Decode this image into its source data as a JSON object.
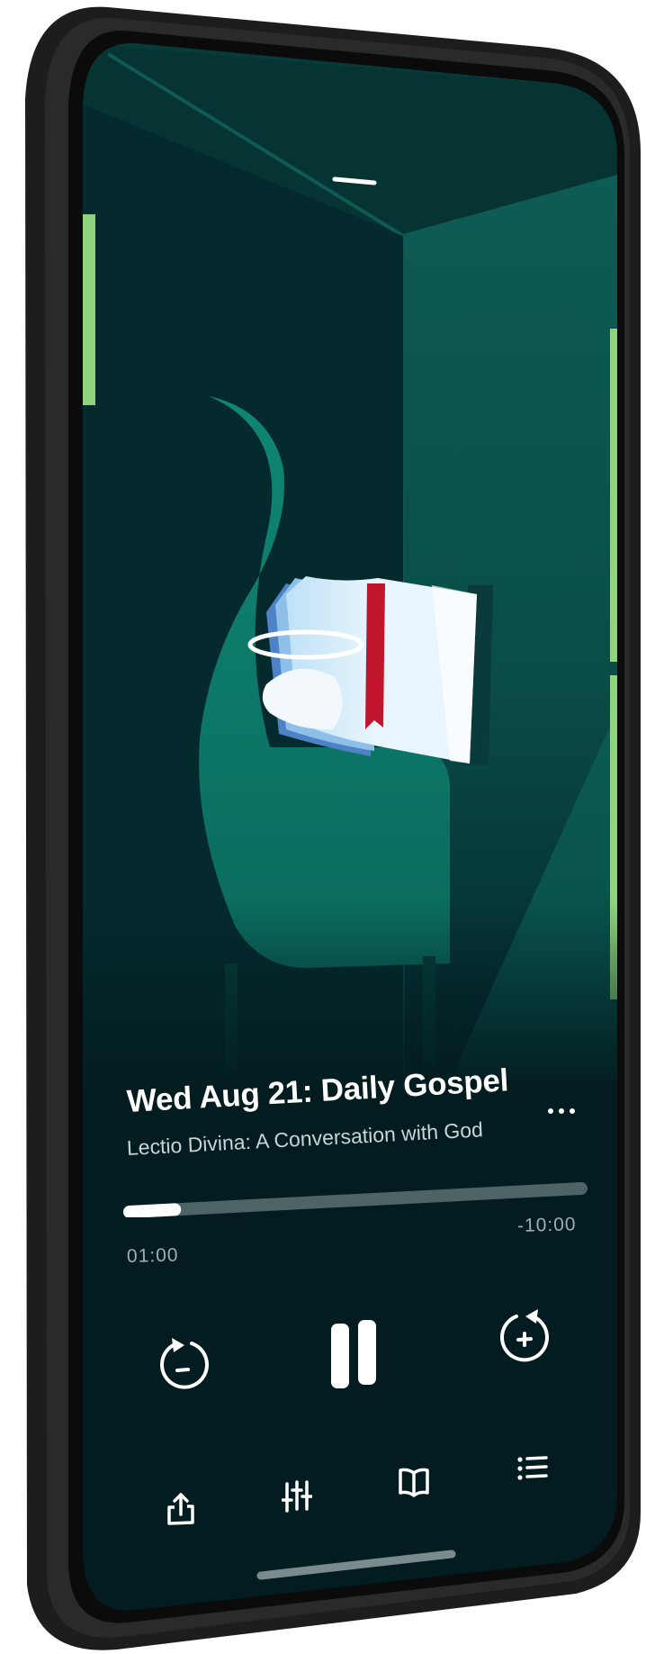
{
  "player": {
    "episode_title": "Wed Aug 21: Daily Gospel",
    "podcast_name": "Lectio Divina: A Conversation with God",
    "elapsed_time": "01:00",
    "remaining_time": "-10:00",
    "progress_fraction": 0.1,
    "more_label": "..."
  },
  "icons": {
    "rewind": "rewind-icon",
    "pause": "pause-icon",
    "forward": "fast-forward-icon",
    "share": "share-icon",
    "equalizer": "sliders-icon",
    "book": "book-icon",
    "queue": "list-icon",
    "grabber": "sheet-handle"
  },
  "colors": {
    "accent_green": "#8fd37d",
    "chair_teal": "#0d7c6c",
    "background_dark": "#031c20",
    "book_red": "#c0152d"
  }
}
